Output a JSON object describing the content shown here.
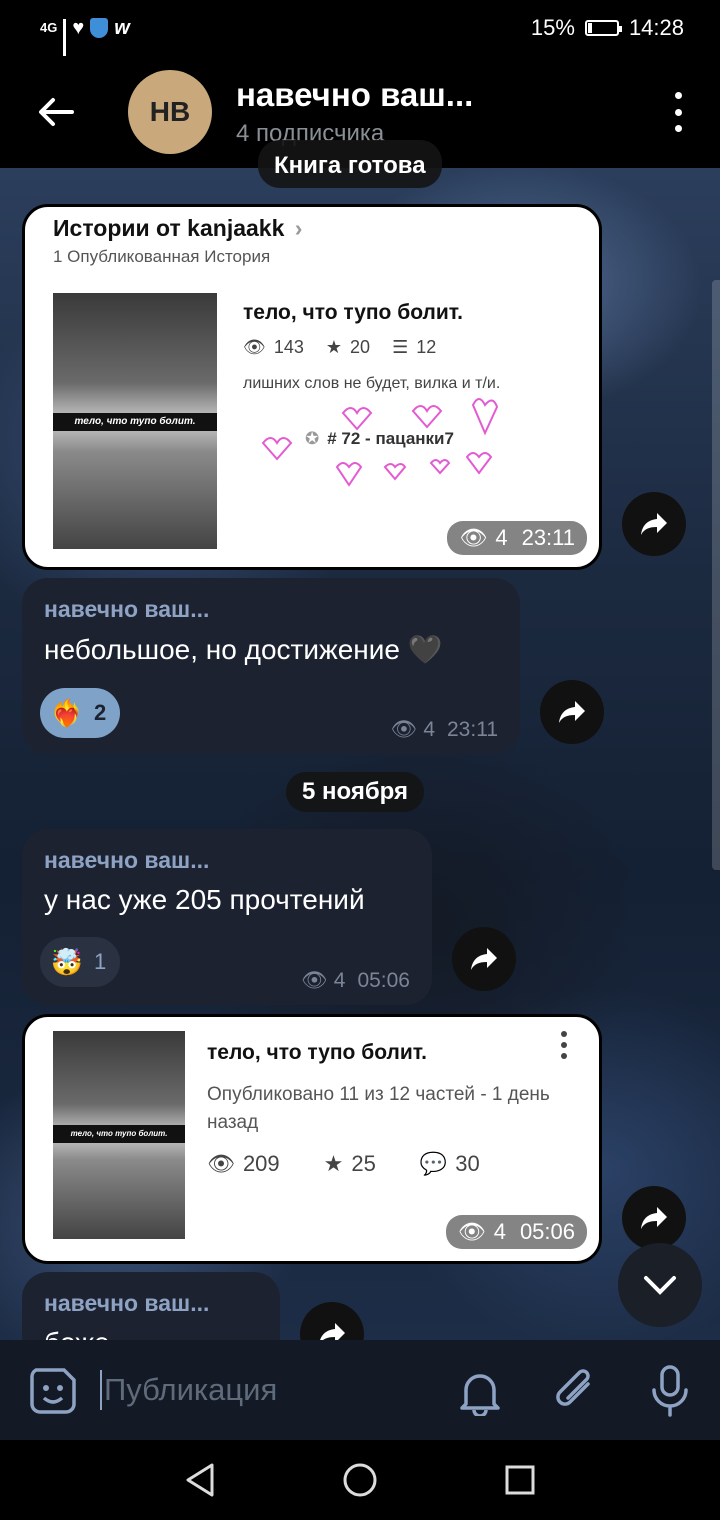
{
  "status_bar": {
    "network": "4G",
    "battery_percent": "15%",
    "battery_level": 0.15,
    "time": "14:28"
  },
  "header": {
    "avatar_initials": "НВ",
    "title": "навечно ваш...",
    "subtitle": "4 подписчика"
  },
  "top_pill": "Книга готова",
  "date_separator": "5 ноября",
  "card1": {
    "author_line": "Истории от kanjaakk",
    "published_count": "1 Опубликованная История",
    "thumb_caption": "тело, что тупо болит.",
    "story_title": "тело, что тупо болит.",
    "views": "143",
    "stars": "20",
    "parts": "12",
    "description": "лишних слов не будет, вилка и т/и.",
    "rank": "# 72 - пацанки7",
    "meta_views": "4",
    "meta_time": "23:11"
  },
  "msg1": {
    "author": "навечно ваш...",
    "text": "небольшое, но достижение 🖤",
    "reaction_emoji": "❤️‍🔥",
    "reaction_count": "2",
    "views": "4",
    "time": "23:11"
  },
  "msg2": {
    "author": "навечно ваш...",
    "text": "у нас уже 205 прочтений",
    "reaction_emoji": "🤯",
    "reaction_count": "1",
    "views": "4",
    "time": "05:06"
  },
  "card2": {
    "thumb_caption": "тело, что тупо болит.",
    "story_title": "тело, что тупо болит.",
    "published": "Опубликовано 11 из 12 частей - 1 день назад",
    "views": "209",
    "stars": "25",
    "comments": "30",
    "meta_views": "4",
    "meta_time": "05:06"
  },
  "msg3": {
    "author": "навечно ваш...",
    "text": "боже"
  },
  "input": {
    "placeholder": "Публикация"
  },
  "colors": {
    "accent": "#8ea2c4",
    "bubble": "#1c2230",
    "avatar": "#c9a97c",
    "heart_doodle": "#e45ad2"
  }
}
